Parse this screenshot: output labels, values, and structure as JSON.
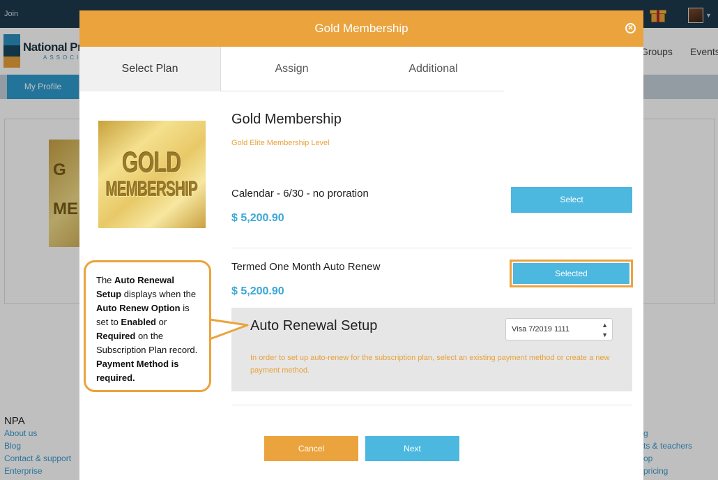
{
  "background": {
    "topbar": {
      "join": "Join"
    },
    "logo": {
      "name": "National Pr",
      "sub": "ASSOCI"
    },
    "nav": {
      "groups": "Groups",
      "events": "Events"
    },
    "subnav": {
      "my_profile": "My Profile"
    },
    "bg_gold_text": [
      "G",
      "ME"
    ],
    "footer": {
      "title": "NPA",
      "links": [
        "About us",
        "Blog",
        "Contact & support",
        "Enterprise"
      ],
      "right_links": [
        "g",
        "ts & teachers",
        "op",
        "pricing"
      ]
    }
  },
  "modal": {
    "title": "Gold Membership",
    "tabs": [
      {
        "label": "Select Plan",
        "active": true
      },
      {
        "label": "Assign",
        "active": false
      },
      {
        "label": "Additional",
        "active": false
      }
    ],
    "plan_image_text": {
      "line1": "GOLD",
      "line2": "MEMBERSHIP"
    },
    "plan": {
      "title": "Gold Membership",
      "subtitle": "Gold Elite Membership Level"
    },
    "options": [
      {
        "name": "Calendar - 6/30 - no proration",
        "price": "$ 5,200.90",
        "button": "Select"
      },
      {
        "name": "Termed One Month Auto Renew",
        "price": "$ 5,200.90",
        "button": "Selected"
      }
    ],
    "auto_renewal": {
      "title": "Auto Renewal Setup",
      "payment_method": "Visa 7/2019 1111",
      "note": "In order to set up auto-renew for the subscription plan, select an existing payment method or create a new payment method."
    },
    "buttons": {
      "cancel": "Cancel",
      "next": "Next"
    }
  },
  "callout": {
    "p1": "The ",
    "b1": "Auto Renewal Setup",
    "p2": " displays when the ",
    "b2": "Auto Renew Option",
    "p3": " is set to ",
    "b3": "Enabled",
    "p4": " or ",
    "b4": "Required",
    "p5": " on the Subscription Plan record. ",
    "b5": "Payment Method is required."
  },
  "colors": {
    "accent_orange": "#eba33e",
    "accent_blue": "#4cb8df",
    "topbar": "#1e3a4c"
  }
}
